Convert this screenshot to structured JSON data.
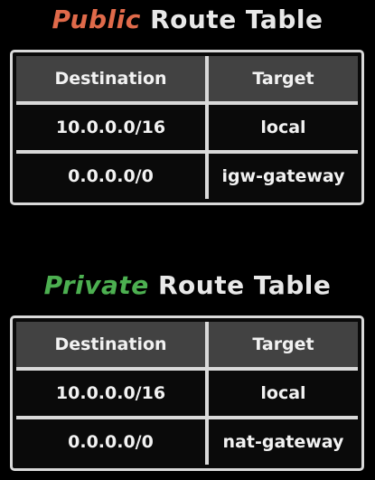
{
  "colors": {
    "public_accent": "#e06a4a",
    "private_accent": "#4caf50",
    "title_text": "#e8e8e8",
    "header_bg": "#424242",
    "border": "#d9d9d9"
  },
  "public_table": {
    "title_kind": "Public",
    "title_rest": "Route Table",
    "headers": {
      "destination": "Destination",
      "target": "Target"
    },
    "rows": [
      {
        "destination": "10.0.0.0/16",
        "target": "local"
      },
      {
        "destination": "0.0.0.0/0",
        "target": "igw-gateway"
      }
    ]
  },
  "private_table": {
    "title_kind": "Private",
    "title_rest": "Route Table",
    "headers": {
      "destination": "Destination",
      "target": "Target"
    },
    "rows": [
      {
        "destination": "10.0.0.0/16",
        "target": "local"
      },
      {
        "destination": "0.0.0.0/0",
        "target": "nat-gateway"
      }
    ]
  }
}
